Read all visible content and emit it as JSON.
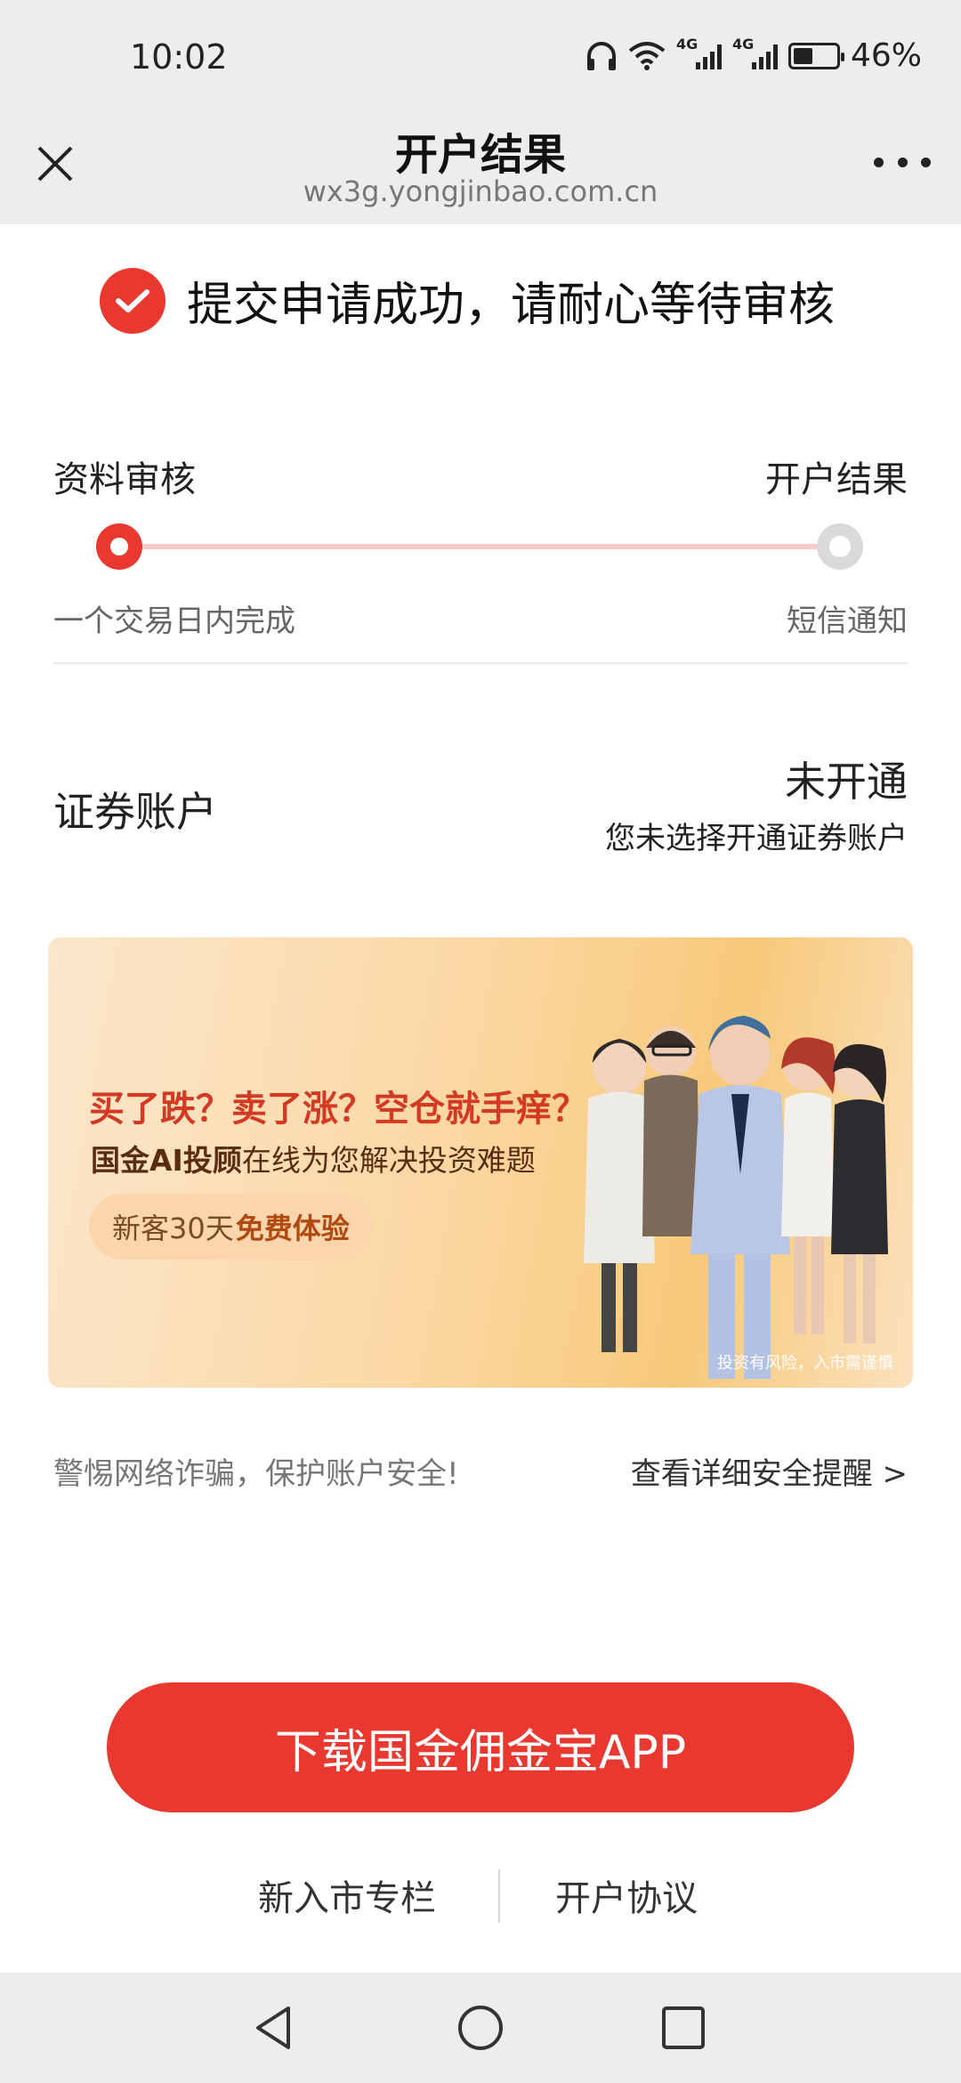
{
  "status_bar": {
    "time": "10:02",
    "network_1": "4G",
    "network_2": "4G",
    "battery": "46%",
    "battery_level": 0.46
  },
  "nav": {
    "title": "开户结果",
    "url": "wx3g.yongjinbao.com.cn"
  },
  "success_message": "提交申请成功，请耐心等待审核",
  "progress": {
    "step1_title": "资料审核",
    "step1_sub": "一个交易日内完成",
    "step2_title": "开户结果",
    "step2_sub": "短信通知"
  },
  "account": {
    "label": "证券账户",
    "status": "未开通",
    "desc": "您未选择开通证券账户"
  },
  "banner": {
    "headline": "买了跌？卖了涨？空仓就手痒？",
    "sub_bold": "国金AI投顾",
    "sub_rest": "在线为您解决投资难题",
    "pill_text": "新客30天",
    "pill_bold": "免费体验",
    "risk_note": "投资有风险，入市需谨慎"
  },
  "safety": {
    "warning": "警惕网络诈骗，保护账户安全!",
    "link": "查看详细安全提醒 >"
  },
  "download_button": "下载国金佣金宝APP",
  "footer": {
    "link_left": "新入市专栏",
    "link_right": "开户协议"
  },
  "colors": {
    "accent": "#e8382f",
    "track": "#f7caca",
    "bar_bg": "#ededed"
  }
}
